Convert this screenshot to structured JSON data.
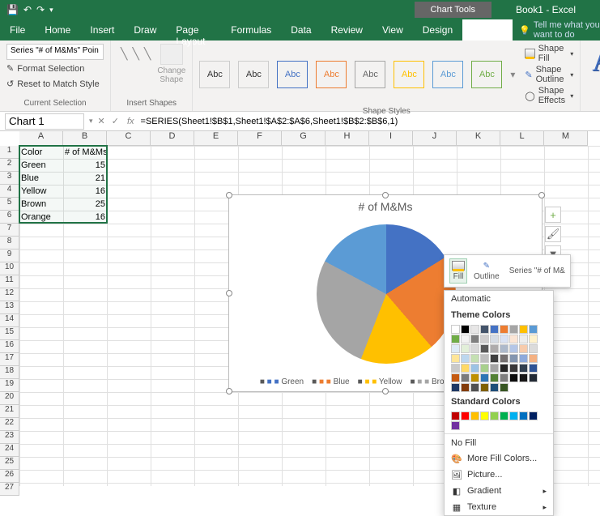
{
  "title_bar": {
    "context_tab": "Chart Tools",
    "doc_title": "Book1 - Excel"
  },
  "tabs": {
    "file": "File",
    "home": "Home",
    "insert": "Insert",
    "draw": "Draw",
    "page_layout": "Page Layout",
    "formulas": "Formulas",
    "data": "Data",
    "review": "Review",
    "view": "View",
    "design": "Design",
    "format": "Format",
    "tell_me": "Tell me what you want to do"
  },
  "ribbon": {
    "selection": {
      "combo": "Series \"# of M&Ms\" Poin",
      "format_selection": "Format Selection",
      "reset": "Reset to Match Style",
      "group": "Current Selection"
    },
    "insert_shapes": {
      "change": "Change\nShape",
      "group": "Insert Shapes"
    },
    "shape_styles": {
      "swatch_label": "Abc",
      "fill": "Shape Fill",
      "outline": "Shape Outline",
      "effects": "Shape Effects",
      "group": "Shape Styles"
    }
  },
  "formula_bar": {
    "name": "Chart 1",
    "value": "=SERIES(Sheet1!$B$1,Sheet1!$A$2:$A$6,Sheet1!$B$2:$B$6,1)"
  },
  "columns": [
    "A",
    "B",
    "C",
    "D",
    "E",
    "F",
    "G",
    "H",
    "I",
    "J",
    "K",
    "L",
    "M"
  ],
  "rows": 27,
  "cells": {
    "a1": "Color",
    "b1": "# of M&Ms",
    "a2": "Green",
    "b2": "15",
    "a3": "Blue",
    "b3": "21",
    "a4": "Yellow",
    "b4": "16",
    "a5": "Brown",
    "b5": "25",
    "a6": "Orange",
    "b6": "16"
  },
  "chart_data": {
    "type": "pie",
    "title": "# of M&Ms",
    "categories": [
      "Green",
      "Blue",
      "Yellow",
      "Brown",
      "Orange"
    ],
    "values": [
      15,
      21,
      16,
      25,
      16
    ],
    "colors": [
      "#4472C4",
      "#ED7D31",
      "#FFC000",
      "#A5A5A5",
      "#5B9BD5"
    ],
    "legend_position": "bottom"
  },
  "mini_toolbar": {
    "fill": "Fill",
    "outline": "Outline",
    "series": "Series \"# of M&"
  },
  "picker": {
    "automatic": "Automatic",
    "theme": "Theme Colors",
    "standard": "Standard Colors",
    "no_fill": "No Fill",
    "more": "More Fill Colors...",
    "picture": "Picture...",
    "gradient": "Gradient",
    "texture": "Texture",
    "theme_colors_row1": [
      "#FFFFFF",
      "#000000",
      "#E7E6E6",
      "#44546A",
      "#4472C4",
      "#ED7D31",
      "#A5A5A5",
      "#FFC000",
      "#5B9BD5",
      "#70AD47"
    ],
    "theme_shades": [
      [
        "#F2F2F2",
        "#7F7F7F",
        "#D0CECE",
        "#D6DCE4",
        "#D9E2F3",
        "#FBE5D5",
        "#EDEDED",
        "#FFF2CC",
        "#DEEBF6",
        "#E2EFD9"
      ],
      [
        "#D8D8D8",
        "#595959",
        "#AEABAB",
        "#ADB9CA",
        "#B4C6E7",
        "#F7CBAC",
        "#DBDBDB",
        "#FEE599",
        "#BDD7EE",
        "#C5E0B3"
      ],
      [
        "#BFBFBF",
        "#3F3F3F",
        "#757070",
        "#8496B0",
        "#8EAADB",
        "#F4B183",
        "#C9C9C9",
        "#FFD965",
        "#9CC3E5",
        "#A8D08D"
      ],
      [
        "#A5A5A5",
        "#262626",
        "#3A3838",
        "#323F4F",
        "#2F5496",
        "#C55A11",
        "#7B7B7B",
        "#BF9000",
        "#2E75B5",
        "#538135"
      ],
      [
        "#7F7F7F",
        "#0C0C0C",
        "#171616",
        "#222A35",
        "#1F3864",
        "#833C0B",
        "#525252",
        "#7F6000",
        "#1E4E79",
        "#375623"
      ]
    ],
    "standard_colors": [
      "#C00000",
      "#FF0000",
      "#FFC000",
      "#FFFF00",
      "#92D050",
      "#00B050",
      "#00B0F0",
      "#0070C0",
      "#002060",
      "#7030A0"
    ]
  }
}
